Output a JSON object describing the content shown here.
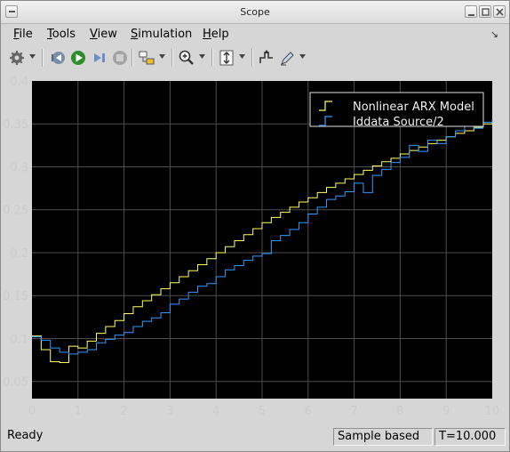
{
  "window": {
    "title": "Scope"
  },
  "menu": [
    {
      "label": "File",
      "mnemonic": "F",
      "rest": "ile"
    },
    {
      "label": "Tools",
      "mnemonic": "T",
      "rest": "ools"
    },
    {
      "label": "View",
      "mnemonic": "V",
      "rest": "iew"
    },
    {
      "label": "Simulation",
      "mnemonic": "S",
      "rest": "imulation"
    },
    {
      "label": "Help",
      "mnemonic": "H",
      "rest": "elp"
    }
  ],
  "toolbar": {
    "icons": [
      "gear-icon",
      "step-back-icon",
      "run-icon",
      "step-forward-icon",
      "stop-icon",
      "highlight-block-icon",
      "zoom-icon",
      "scale-axes-icon",
      "triggers-icon",
      "style-icon"
    ]
  },
  "colors": {
    "plot_bg": "#000000",
    "grid": "#4d4d4d",
    "axes_text": "#cccccc",
    "series1": "#ffff66",
    "series2": "#3399ff"
  },
  "chart_data": {
    "type": "line",
    "step": true,
    "xlim": [
      0,
      10
    ],
    "ylim": [
      0.03,
      0.4
    ],
    "xticks": [
      "0",
      "1",
      "2",
      "3",
      "4",
      "5",
      "6",
      "7",
      "8",
      "9",
      "10"
    ],
    "yticks": [
      "0.05",
      "0.1",
      "0.15",
      "0.2",
      "0.25",
      "0.3",
      "0.35",
      "0.4"
    ],
    "grid": true,
    "legend_position": "top-right",
    "x": [
      0,
      0.2,
      0.4,
      0.6,
      0.8,
      1.0,
      1.2,
      1.4,
      1.6,
      1.8,
      2.0,
      2.2,
      2.4,
      2.6,
      2.8,
      3.0,
      3.2,
      3.4,
      3.6,
      3.8,
      4.0,
      4.2,
      4.4,
      4.6,
      4.8,
      5.0,
      5.2,
      5.4,
      5.6,
      5.8,
      6.0,
      6.2,
      6.4,
      6.6,
      6.8,
      7.0,
      7.2,
      7.4,
      7.6,
      7.8,
      8.0,
      8.2,
      8.4,
      8.6,
      8.8,
      9.0,
      9.2,
      9.4,
      9.6,
      9.8,
      10.0
    ],
    "series": [
      {
        "name": "Nonlinear ARX Model",
        "values": [
          0.103,
          0.087,
          0.073,
          0.072,
          0.091,
          0.089,
          0.097,
          0.106,
          0.114,
          0.121,
          0.129,
          0.137,
          0.144,
          0.151,
          0.158,
          0.165,
          0.172,
          0.179,
          0.186,
          0.193,
          0.2,
          0.207,
          0.214,
          0.221,
          0.228,
          0.235,
          0.241,
          0.247,
          0.253,
          0.259,
          0.264,
          0.27,
          0.276,
          0.281,
          0.286,
          0.291,
          0.296,
          0.301,
          0.306,
          0.31,
          0.315,
          0.319,
          0.323,
          0.327,
          0.331,
          0.335,
          0.339,
          0.342,
          0.346,
          0.35,
          0.353
        ]
      },
      {
        "name": "Iddata Source/2",
        "values": [
          0.102,
          0.098,
          0.089,
          0.084,
          0.082,
          0.084,
          0.087,
          0.095,
          0.099,
          0.104,
          0.107,
          0.114,
          0.12,
          0.124,
          0.13,
          0.14,
          0.146,
          0.154,
          0.161,
          0.164,
          0.172,
          0.18,
          0.185,
          0.191,
          0.196,
          0.199,
          0.214,
          0.22,
          0.227,
          0.235,
          0.245,
          0.253,
          0.262,
          0.266,
          0.271,
          0.281,
          0.27,
          0.29,
          0.297,
          0.305,
          0.311,
          0.325,
          0.318,
          0.331,
          0.327,
          0.335,
          0.342,
          0.348,
          0.345,
          0.352,
          0.355
        ]
      }
    ]
  },
  "status": {
    "left": "Ready",
    "mode": "Sample based",
    "time": "T=10.000"
  }
}
